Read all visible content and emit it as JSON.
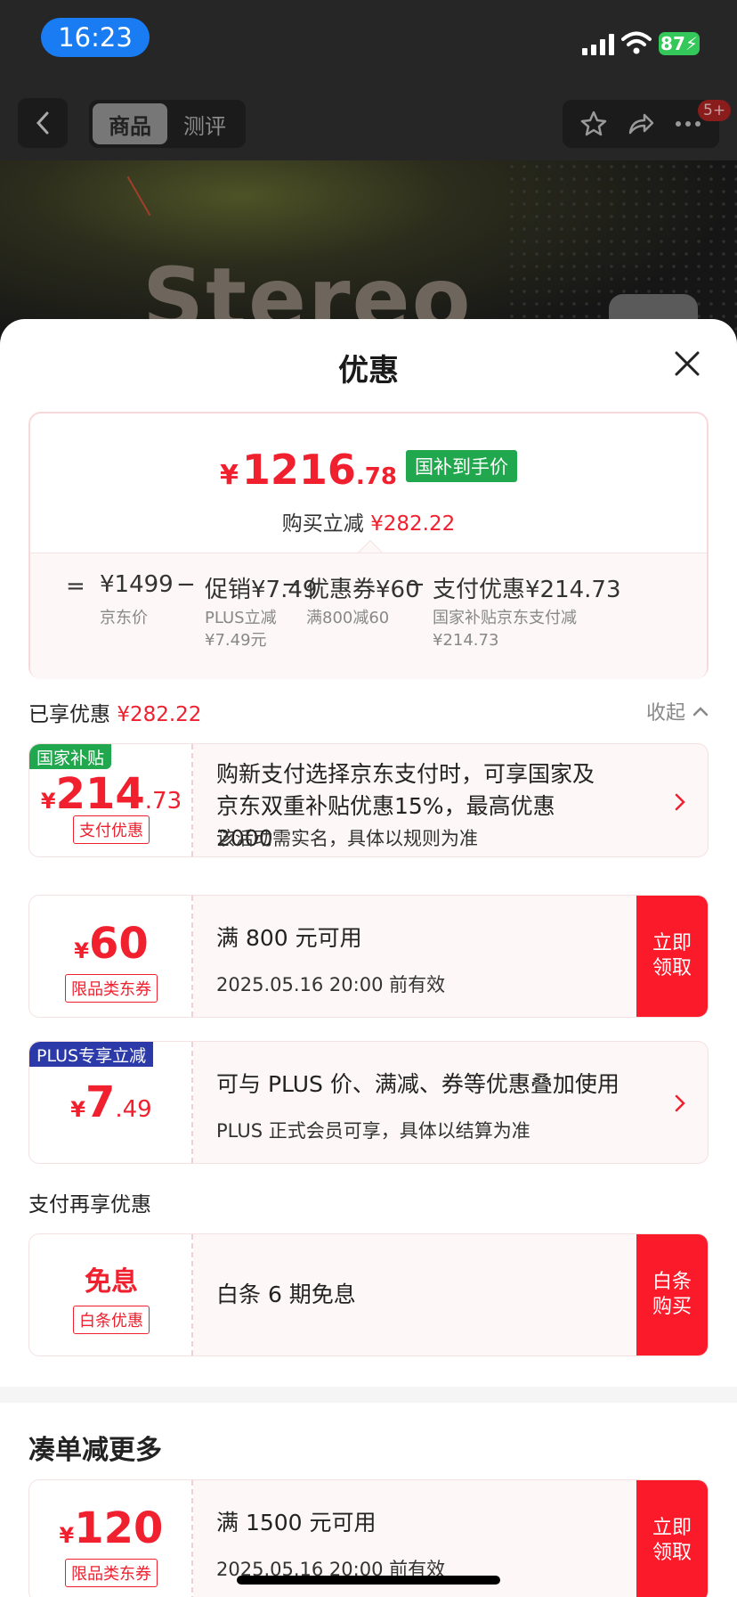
{
  "status_bar": {
    "time": "16:23",
    "battery": "87"
  },
  "nav": {
    "tabs": [
      "商品",
      "测评"
    ],
    "badge": "5+"
  },
  "background": {
    "text": "Stereo"
  },
  "sheet": {
    "title": "优惠",
    "summary": {
      "price_currency": "¥",
      "price_int": "1216",
      "price_dec": ".78",
      "price_tag": "国补到手价",
      "reduce_label": "购买立减",
      "reduce_value": "¥282.22",
      "breakdown": [
        {
          "op": "=",
          "label": "¥1499",
          "sub": "京东价"
        },
        {
          "op": "−",
          "label": "促销¥7.49",
          "sub": "PLUS立减\n¥7.49元"
        },
        {
          "op": "−",
          "label": "优惠券¥60",
          "sub": "满800减60"
        },
        {
          "op": "−",
          "label": "支付优惠¥214.73",
          "sub": "国家补贴京东支付减\n¥214.73"
        }
      ]
    },
    "enjoyed": {
      "label": "已享优惠",
      "value": "¥282.22",
      "collapse": "收起"
    },
    "cards": [
      {
        "corner_tag": "国家补贴",
        "corner_color": "#21a84e",
        "currency": "¥",
        "int": "214",
        "dec": ".73",
        "label": "支付优惠",
        "main": "购新支付选择京东支付时，可享国家及京东双重补贴优惠15%，最高优惠 2000",
        "sub": "该活动需实名，具体以规则为准"
      },
      {
        "currency": "¥",
        "int": "60",
        "dec": "",
        "label": "限品类东券",
        "main": "满 800 元可用",
        "sub": "2025.05.16 20:00 前有效",
        "action": "立即领取"
      },
      {
        "corner_tag": "PLUS专享立减",
        "corner_color": "#2b3aa8",
        "currency": "¥",
        "int": "7",
        "dec": ".49",
        "label": "",
        "main": "可与 PLUS 价、满减、券等优惠叠加使用",
        "sub": "PLUS 正式会员可享，具体以结算为准"
      }
    ],
    "pay_section": {
      "label": "支付再享优惠",
      "card": {
        "title": "免息",
        "label": "白条优惠",
        "main": "白条 6 期免息",
        "action": "白条购买"
      }
    },
    "more_section": {
      "title": "凑单减更多",
      "card": {
        "currency": "¥",
        "int": "120",
        "label": "限品类东券",
        "main": "满 1500 元可用",
        "sub": "2025.05.16 20:00 前有效",
        "action": "立即领取"
      }
    }
  }
}
